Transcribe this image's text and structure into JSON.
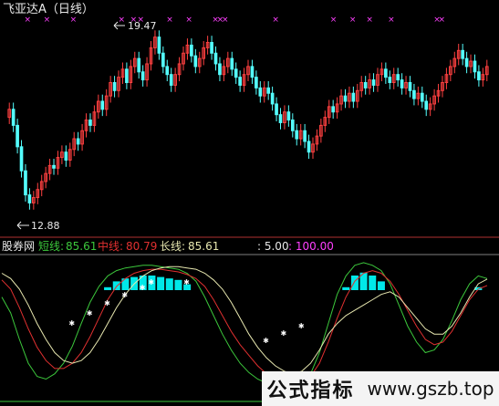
{
  "colors": {
    "up": "#ff4040",
    "down": "#54ffff",
    "background": "#000000",
    "magenta_marker": "#ff40ff",
    "short_line": "#3cc83c",
    "mid_line": "#e03030",
    "long_line": "#e8e8b0",
    "fill": "#00e8e8",
    "axis": "#b03030"
  },
  "header": {
    "title": "飞亚达A（日线）"
  },
  "indicator": {
    "name": "股券网",
    "short_label": "短线:",
    "short_value": "85.61",
    "mid_label": "中线:",
    "mid_value": "80.79",
    "long_label": "长线:",
    "long_value": "85.61",
    "param1": ": 5.00",
    "param2": ": 100.00"
  },
  "annotations": {
    "high_label": "19.47",
    "low_label": "12.88"
  },
  "watermark": {
    "text": "公式指标",
    "url": "www.gszb.top"
  },
  "chart_data": [
    {
      "type": "candlestick",
      "title": "飞亚达A（日线）",
      "ylim": [
        12.5,
        19.8
      ],
      "annotations": [
        {
          "label": "19.47",
          "value": 19.47
        },
        {
          "label": "12.88",
          "value": 12.88
        }
      ],
      "close": [
        16.6,
        16.0,
        15.2,
        14.3,
        13.4,
        13.1,
        13.3,
        13.6,
        13.9,
        14.2,
        14.5,
        14.4,
        14.8,
        15.0,
        14.7,
        15.1,
        15.5,
        15.3,
        15.8,
        16.2,
        16.0,
        16.5,
        16.9,
        16.6,
        17.1,
        17.6,
        17.3,
        17.8,
        18.1,
        17.6,
        18.2,
        18.5,
        18.0,
        17.7,
        18.3,
        18.9,
        19.3,
        18.7,
        18.2,
        17.9,
        17.5,
        17.9,
        18.3,
        18.7,
        19.0,
        18.6,
        18.2,
        18.5,
        18.9,
        19.1,
        18.7,
        18.3,
        17.9,
        18.2,
        18.5,
        18.1,
        17.8,
        17.5,
        17.9,
        18.2,
        17.8,
        17.4,
        17.1,
        17.4,
        17.2,
        16.8,
        16.4,
        16.1,
        16.5,
        16.2,
        15.8,
        15.5,
        15.8,
        15.4,
        15.0,
        15.3,
        15.6,
        16.0,
        16.3,
        16.7,
        16.5,
        16.8,
        17.1,
        16.9,
        17.2,
        16.9,
        17.3,
        17.6,
        17.4,
        17.7,
        17.5,
        17.9,
        18.1,
        17.8,
        17.6,
        17.9,
        17.7,
        17.4,
        17.6,
        17.3,
        17.0,
        17.2,
        16.9,
        16.6,
        16.8,
        17.1,
        17.3,
        17.6,
        17.9,
        18.2,
        18.5,
        18.8,
        18.5,
        18.2,
        18.4,
        18.0,
        17.7,
        17.9,
        18.2
      ],
      "open": [
        16.3,
        16.6,
        16.0,
        15.2,
        14.3,
        13.4,
        13.1,
        13.3,
        13.6,
        13.9,
        14.2,
        14.5,
        14.4,
        14.8,
        15.0,
        14.7,
        15.1,
        15.5,
        15.3,
        15.8,
        16.2,
        16.0,
        16.5,
        16.9,
        16.6,
        17.1,
        17.6,
        17.3,
        17.8,
        18.1,
        17.6,
        18.2,
        18.5,
        18.0,
        17.7,
        18.3,
        18.9,
        19.3,
        18.7,
        18.2,
        17.9,
        17.5,
        17.9,
        18.3,
        18.7,
        19.0,
        18.6,
        18.2,
        18.5,
        18.9,
        19.1,
        18.7,
        18.3,
        17.9,
        18.2,
        18.5,
        18.1,
        17.8,
        17.5,
        17.9,
        18.2,
        17.8,
        17.4,
        17.1,
        17.4,
        17.2,
        16.8,
        16.4,
        16.1,
        16.5,
        16.2,
        15.8,
        15.5,
        15.8,
        15.4,
        15.0,
        15.3,
        15.6,
        16.0,
        16.3,
        16.7,
        16.5,
        16.8,
        17.1,
        16.9,
        17.2,
        16.9,
        17.3,
        17.6,
        17.4,
        17.7,
        17.5,
        17.9,
        18.1,
        17.8,
        17.6,
        17.9,
        17.7,
        17.4,
        17.6,
        17.3,
        17.0,
        17.2,
        16.9,
        16.6,
        16.8,
        17.1,
        17.3,
        17.6,
        17.9,
        18.2,
        18.5,
        18.8,
        18.5,
        18.2,
        18.4,
        18.0,
        17.7,
        17.9
      ]
    },
    {
      "type": "line",
      "title": "股券网",
      "ylim": [
        0,
        100
      ],
      "series": [
        {
          "name": "短线",
          "values": [
            72,
            60,
            40,
            22,
            12,
            10,
            14,
            22,
            35,
            52,
            68,
            80,
            88,
            92,
            94,
            95,
            96,
            96,
            95,
            94,
            93,
            90,
            84,
            72,
            58,
            44,
            32,
            22,
            15,
            10,
            7,
            5,
            5,
            6,
            8,
            14,
            30,
            52,
            74,
            88,
            96,
            98,
            96,
            92,
            82,
            66,
            50,
            38,
            30,
            32,
            40,
            54,
            70,
            82,
            88,
            86
          ]
        },
        {
          "name": "中线",
          "values": [
            85,
            78,
            64,
            48,
            34,
            24,
            18,
            18,
            22,
            30,
            42,
            56,
            70,
            80,
            86,
            90,
            92,
            93,
            93,
            92,
            91,
            89,
            86,
            80,
            70,
            58,
            46,
            36,
            28,
            20,
            14,
            10,
            8,
            7,
            8,
            12,
            22,
            38,
            56,
            72,
            84,
            90,
            92,
            90,
            84,
            74,
            62,
            50,
            40,
            36,
            38,
            46,
            58,
            70,
            78,
            80.79
          ]
        },
        {
          "name": "长线",
          "values": [
            90,
            86,
            78,
            66,
            52,
            40,
            30,
            24,
            22,
            24,
            30,
            40,
            52,
            64,
            74,
            82,
            88,
            92,
            94,
            95,
            95,
            94,
            93,
            90,
            85,
            78,
            68,
            56,
            44,
            34,
            26,
            20,
            16,
            14,
            16,
            22,
            32,
            44,
            52,
            58,
            62,
            66,
            70,
            74,
            76,
            72,
            64,
            56,
            48,
            44,
            44,
            50,
            60,
            72,
            82,
            85.61
          ]
        }
      ]
    }
  ]
}
